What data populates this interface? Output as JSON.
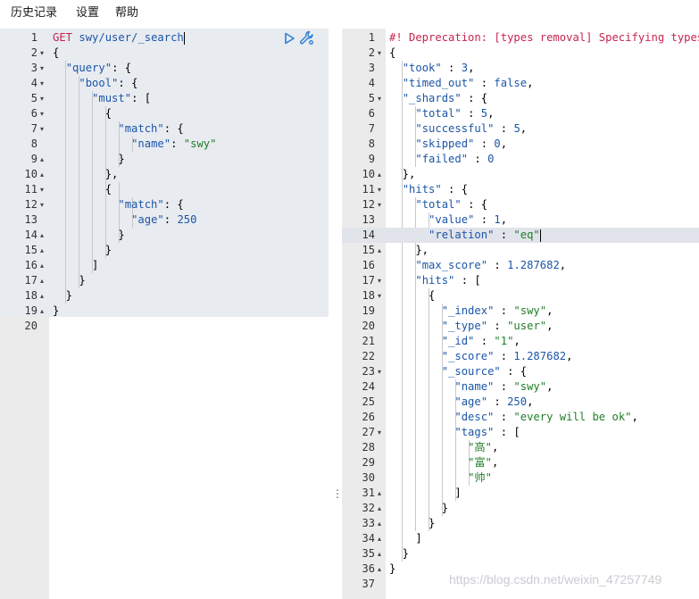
{
  "menu": {
    "history": "历史记录",
    "settings": "设置",
    "help": "帮助"
  },
  "request": {
    "lines": [
      [
        [
          "t-method",
          "GET"
        ],
        [
          "t-punc",
          " "
        ],
        [
          "t-url",
          "swy/user/_search"
        ]
      ],
      [
        [
          "t-punc",
          "{"
        ]
      ],
      [
        [
          "t-punc",
          "  "
        ],
        [
          "t-key",
          "\"query\""
        ],
        [
          "t-punc",
          ": {"
        ]
      ],
      [
        [
          "t-punc",
          "    "
        ],
        [
          "t-key",
          "\"bool\""
        ],
        [
          "t-punc",
          ": {"
        ]
      ],
      [
        [
          "t-punc",
          "      "
        ],
        [
          "t-key",
          "\"must\""
        ],
        [
          "t-punc",
          ": ["
        ]
      ],
      [
        [
          "t-punc",
          "        {"
        ]
      ],
      [
        [
          "t-punc",
          "          "
        ],
        [
          "t-key",
          "\"match\""
        ],
        [
          "t-punc",
          ": {"
        ]
      ],
      [
        [
          "t-punc",
          "            "
        ],
        [
          "t-key",
          "\"name\""
        ],
        [
          "t-punc",
          ": "
        ],
        [
          "t-str",
          "\"swy\""
        ]
      ],
      [
        [
          "t-punc",
          "          }"
        ]
      ],
      [
        [
          "t-punc",
          "        },"
        ]
      ],
      [
        [
          "t-punc",
          "        {"
        ]
      ],
      [
        [
          "t-punc",
          "          "
        ],
        [
          "t-key",
          "\"match\""
        ],
        [
          "t-punc",
          ": {"
        ]
      ],
      [
        [
          "t-punc",
          "            "
        ],
        [
          "t-key",
          "\"age\""
        ],
        [
          "t-punc",
          ": "
        ],
        [
          "t-num",
          "250"
        ]
      ],
      [
        [
          "t-punc",
          "          }"
        ]
      ],
      [
        [
          "t-punc",
          "        }"
        ]
      ],
      [
        [
          "t-punc",
          "      ]"
        ]
      ],
      [
        [
          "t-punc",
          "    }"
        ]
      ],
      [
        [
          "t-punc",
          "  }"
        ]
      ],
      [
        [
          "t-punc",
          "}"
        ]
      ],
      []
    ],
    "folds": {
      "2": "down",
      "3": "down",
      "4": "down",
      "5": "down",
      "6": "down",
      "7": "down",
      "9": "up",
      "10": "up",
      "11": "down",
      "12": "down",
      "14": "up",
      "15": "up",
      "16": "up",
      "17": "up",
      "18": "up",
      "19": "up"
    }
  },
  "response": {
    "lines": [
      [
        [
          "t-comment",
          "#! Deprecation: [types removal] Specifying types"
        ]
      ],
      [
        [
          "t-punc",
          "{"
        ]
      ],
      [
        [
          "t-punc",
          "  "
        ],
        [
          "t-key",
          "\"took\""
        ],
        [
          "t-punc",
          " : "
        ],
        [
          "t-num",
          "3"
        ],
        [
          "t-punc",
          ","
        ]
      ],
      [
        [
          "t-punc",
          "  "
        ],
        [
          "t-key",
          "\"timed_out\""
        ],
        [
          "t-punc",
          " : "
        ],
        [
          "t-bool",
          "false"
        ],
        [
          "t-punc",
          ","
        ]
      ],
      [
        [
          "t-punc",
          "  "
        ],
        [
          "t-key",
          "\"_shards\""
        ],
        [
          "t-punc",
          " : {"
        ]
      ],
      [
        [
          "t-punc",
          "    "
        ],
        [
          "t-key",
          "\"total\""
        ],
        [
          "t-punc",
          " : "
        ],
        [
          "t-num",
          "5"
        ],
        [
          "t-punc",
          ","
        ]
      ],
      [
        [
          "t-punc",
          "    "
        ],
        [
          "t-key",
          "\"successful\""
        ],
        [
          "t-punc",
          " : "
        ],
        [
          "t-num",
          "5"
        ],
        [
          "t-punc",
          ","
        ]
      ],
      [
        [
          "t-punc",
          "    "
        ],
        [
          "t-key",
          "\"skipped\""
        ],
        [
          "t-punc",
          " : "
        ],
        [
          "t-num",
          "0"
        ],
        [
          "t-punc",
          ","
        ]
      ],
      [
        [
          "t-punc",
          "    "
        ],
        [
          "t-key",
          "\"failed\""
        ],
        [
          "t-punc",
          " : "
        ],
        [
          "t-num",
          "0"
        ]
      ],
      [
        [
          "t-punc",
          "  },"
        ]
      ],
      [
        [
          "t-punc",
          "  "
        ],
        [
          "t-key",
          "\"hits\""
        ],
        [
          "t-punc",
          " : {"
        ]
      ],
      [
        [
          "t-punc",
          "    "
        ],
        [
          "t-key",
          "\"total\""
        ],
        [
          "t-punc",
          " : {"
        ]
      ],
      [
        [
          "t-punc",
          "      "
        ],
        [
          "t-key",
          "\"value\""
        ],
        [
          "t-punc",
          " : "
        ],
        [
          "t-num",
          "1"
        ],
        [
          "t-punc",
          ","
        ]
      ],
      [
        [
          "t-punc",
          "      "
        ],
        [
          "t-key",
          "\"relation\""
        ],
        [
          "t-punc",
          " : "
        ],
        [
          "t-str",
          "\"eq\""
        ]
      ],
      [
        [
          "t-punc",
          "    },"
        ]
      ],
      [
        [
          "t-punc",
          "    "
        ],
        [
          "t-key",
          "\"max_score\""
        ],
        [
          "t-punc",
          " : "
        ],
        [
          "t-num",
          "1.287682"
        ],
        [
          "t-punc",
          ","
        ]
      ],
      [
        [
          "t-punc",
          "    "
        ],
        [
          "t-key",
          "\"hits\""
        ],
        [
          "t-punc",
          " : ["
        ]
      ],
      [
        [
          "t-punc",
          "      {"
        ]
      ],
      [
        [
          "t-punc",
          "        "
        ],
        [
          "t-key",
          "\"_index\""
        ],
        [
          "t-punc",
          " : "
        ],
        [
          "t-str",
          "\"swy\""
        ],
        [
          "t-punc",
          ","
        ]
      ],
      [
        [
          "t-punc",
          "        "
        ],
        [
          "t-key",
          "\"_type\""
        ],
        [
          "t-punc",
          " : "
        ],
        [
          "t-str",
          "\"user\""
        ],
        [
          "t-punc",
          ","
        ]
      ],
      [
        [
          "t-punc",
          "        "
        ],
        [
          "t-key",
          "\"_id\""
        ],
        [
          "t-punc",
          " : "
        ],
        [
          "t-str",
          "\"1\""
        ],
        [
          "t-punc",
          ","
        ]
      ],
      [
        [
          "t-punc",
          "        "
        ],
        [
          "t-key",
          "\"_score\""
        ],
        [
          "t-punc",
          " : "
        ],
        [
          "t-num",
          "1.287682"
        ],
        [
          "t-punc",
          ","
        ]
      ],
      [
        [
          "t-punc",
          "        "
        ],
        [
          "t-key",
          "\"_source\""
        ],
        [
          "t-punc",
          " : {"
        ]
      ],
      [
        [
          "t-punc",
          "          "
        ],
        [
          "t-key",
          "\"name\""
        ],
        [
          "t-punc",
          " : "
        ],
        [
          "t-str",
          "\"swy\""
        ],
        [
          "t-punc",
          ","
        ]
      ],
      [
        [
          "t-punc",
          "          "
        ],
        [
          "t-key",
          "\"age\""
        ],
        [
          "t-punc",
          " : "
        ],
        [
          "t-num",
          "250"
        ],
        [
          "t-punc",
          ","
        ]
      ],
      [
        [
          "t-punc",
          "          "
        ],
        [
          "t-key",
          "\"desc\""
        ],
        [
          "t-punc",
          " : "
        ],
        [
          "t-str",
          "\"every will be ok\""
        ],
        [
          "t-punc",
          ","
        ]
      ],
      [
        [
          "t-punc",
          "          "
        ],
        [
          "t-key",
          "\"tags\""
        ],
        [
          "t-punc",
          " : ["
        ]
      ],
      [
        [
          "t-punc",
          "            "
        ],
        [
          "t-str",
          "\"高\""
        ],
        [
          "t-punc",
          ","
        ]
      ],
      [
        [
          "t-punc",
          "            "
        ],
        [
          "t-str",
          "\"富\""
        ],
        [
          "t-punc",
          ","
        ]
      ],
      [
        [
          "t-punc",
          "            "
        ],
        [
          "t-str",
          "\"帅\""
        ]
      ],
      [
        [
          "t-punc",
          "          ]"
        ]
      ],
      [
        [
          "t-punc",
          "        }"
        ]
      ],
      [
        [
          "t-punc",
          "      }"
        ]
      ],
      [
        [
          "t-punc",
          "    ]"
        ]
      ],
      [
        [
          "t-punc",
          "  }"
        ]
      ],
      [
        [
          "t-punc",
          "}"
        ]
      ],
      []
    ],
    "folds": {
      "2": "down",
      "5": "down",
      "10": "up",
      "11": "down",
      "12": "down",
      "15": "up",
      "17": "down",
      "18": "down",
      "23": "down",
      "27": "down",
      "31": "up",
      "32": "up",
      "33": "up",
      "34": "up",
      "35": "up",
      "36": "up"
    }
  },
  "watermark": "https://blog.csdn.net/weixin_47257749",
  "colors": {
    "accent": "#2c7fd3",
    "gutter": "#ebebeb",
    "request_bg": "#e8ebf0"
  }
}
